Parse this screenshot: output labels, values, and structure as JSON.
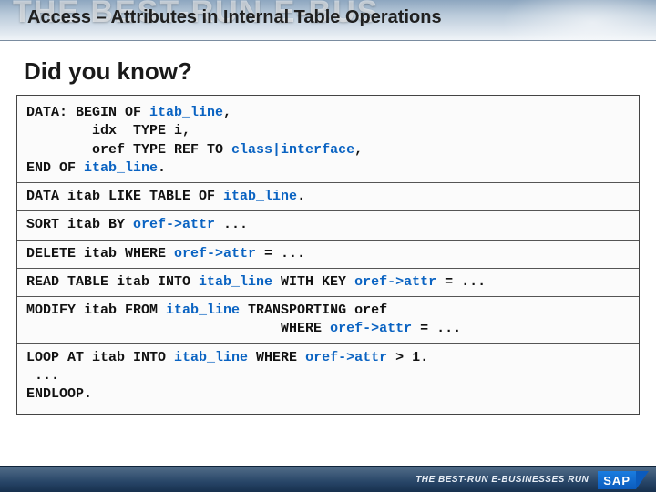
{
  "header": {
    "bg_text": "THE BEST-RUN E-BUS",
    "title": "Access – Attributes in Internal Table Operations"
  },
  "subtitle": "Did you know?",
  "code": {
    "block1_pre": "DATA: BEGIN OF ",
    "block1_hl1": "itab_line",
    "block1_mid1": ",\n        idx  TYPE i,\n        oref TYPE REF TO ",
    "block1_hl2": "class|interface",
    "block1_mid2": ",\nEND OF ",
    "block1_hl3": "itab_line",
    "block1_end": ".",
    "block2_pre": "DATA itab LIKE TABLE OF ",
    "block2_hl": "itab_line",
    "block2_end": ".",
    "block3_pre": "SORT itab BY ",
    "block3_hl": "oref->attr",
    "block3_end": " ...",
    "block4_pre": "DELETE itab WHERE ",
    "block4_hl": "oref->attr",
    "block4_end": " = ...",
    "block5_pre": "READ TABLE itab INTO ",
    "block5_hl1": "itab_line",
    "block5_mid": " WITH KEY ",
    "block5_hl2": "oref->attr",
    "block5_end": " = ...",
    "block6_line1_pre": "MODIFY itab FROM ",
    "block6_line1_hl": "itab_line",
    "block6_line1_end": " TRANSPORTING oref",
    "block6_line2_pre": "                               WHERE ",
    "block6_line2_hl": "oref->attr",
    "block6_line2_end": " = ...",
    "block7_line1_pre": "LOOP AT itab INTO ",
    "block7_line1_hl1": "itab_line",
    "block7_line1_mid": " WHERE ",
    "block7_line1_hl2": "oref->attr",
    "block7_line1_end": " > 1.",
    "block7_line2": " ...",
    "block7_line3": "ENDLOOP."
  },
  "footer": {
    "tagline": "THE BEST-RUN E-BUSINESSES RUN",
    "logo_text": "SAP"
  }
}
